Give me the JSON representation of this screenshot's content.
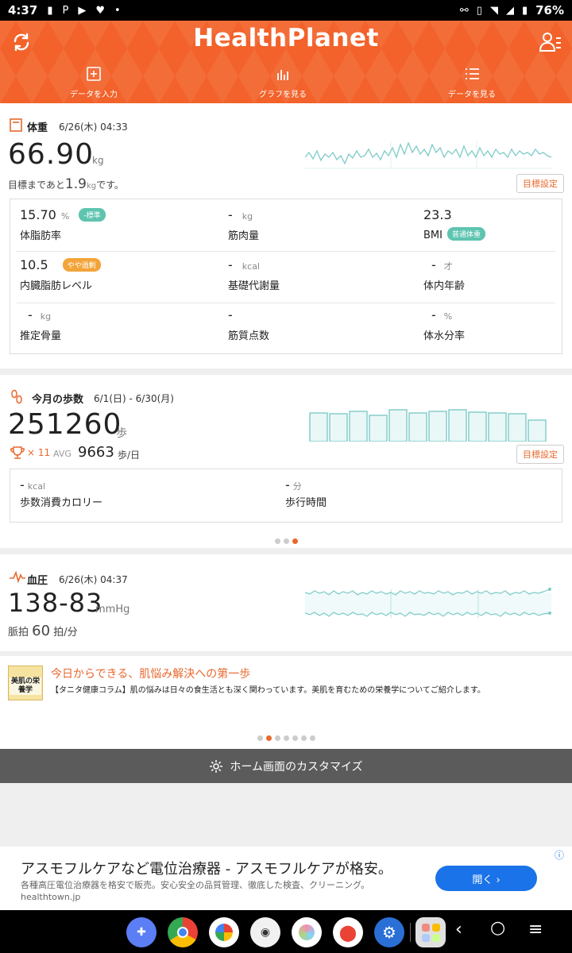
{
  "status": {
    "time": "4:37",
    "battery": "76%"
  },
  "header": {
    "logo": "HealthPlanet",
    "tabs": [
      {
        "label": "データを入力",
        "icon": "plus-box-icon"
      },
      {
        "label": "グラフを見る",
        "icon": "bar-graph-icon"
      },
      {
        "label": "データを見る",
        "icon": "list-icon"
      }
    ]
  },
  "weight": {
    "title": "体重",
    "date": "6/26(木) 04:33",
    "value": "66.90",
    "unit": "kg",
    "goal_prefix": "目標まであと",
    "goal_value": "1.9",
    "goal_unit": "kg",
    "goal_suffix": "です。",
    "goal_button": "目標設定",
    "metrics": [
      {
        "value": "15.70",
        "unit": "%",
        "label": "体脂肪率",
        "badge": "-標準",
        "badge_color": "#5ec4b0"
      },
      {
        "value": "-",
        "unit": "kg",
        "label": "筋肉量"
      },
      {
        "value": "23.3",
        "unit": "",
        "label": "BMI",
        "badge": "普通体重",
        "badge_color": "#5ec4b0"
      },
      {
        "value": "10.5",
        "unit": "",
        "label": "内臓脂肪レベル",
        "badge": "やや過剰",
        "badge_color": "#f2a43a"
      },
      {
        "value": "-",
        "unit": "kcal",
        "label": "基礎代謝量"
      },
      {
        "value": "-",
        "unit": "才",
        "label": "体内年齢"
      },
      {
        "value": "-",
        "unit": "kg",
        "label": "推定骨量"
      },
      {
        "value": "-",
        "unit": "",
        "label": "筋質点数"
      },
      {
        "value": "-",
        "unit": "%",
        "label": "体水分率"
      }
    ]
  },
  "steps": {
    "title": "今月の歩数",
    "date": "6/1(日) - 6/30(月)",
    "value": "251260",
    "unit": "歩",
    "trophy_count": "× 11",
    "avg_label": "AVG",
    "avg_value": "9663",
    "avg_unit": "歩/日",
    "goal_button": "目標設定",
    "kcal_value": "-",
    "kcal_unit": "kcal",
    "kcal_label": "歩数消費カロリー",
    "time_value": "-",
    "time_unit": "分",
    "time_label": "歩行時間"
  },
  "bp": {
    "title": "血圧",
    "date": "6/26(木) 04:37",
    "value": "138-83",
    "unit": "mmHg",
    "pulse_label": "脈拍",
    "pulse_value": "60",
    "pulse_unit": "拍/分"
  },
  "column": {
    "thumb_text": "美肌の栄養学",
    "title": "今日からできる、肌悩み解決への第一歩",
    "body": "【タニタ健康コラム】肌の悩みは日々の食生活とも深く関わっています。美肌を育むための栄養学についてご紹介します。"
  },
  "customize": {
    "label": "ホーム画面のカスタマイズ"
  },
  "ad": {
    "title": "アスモフルケアなど電位治療器 - アスモフルケアが格安。",
    "desc": "各種高圧電位治療器を格安で販売。安心安全の品質管理、徹底した検査、クリーニング。",
    "url": "healthtown.jp",
    "button": "開く ›"
  },
  "colors": {
    "brand": "#f2622a",
    "accent": "#e8682e",
    "graph": "#7ecbc9"
  }
}
